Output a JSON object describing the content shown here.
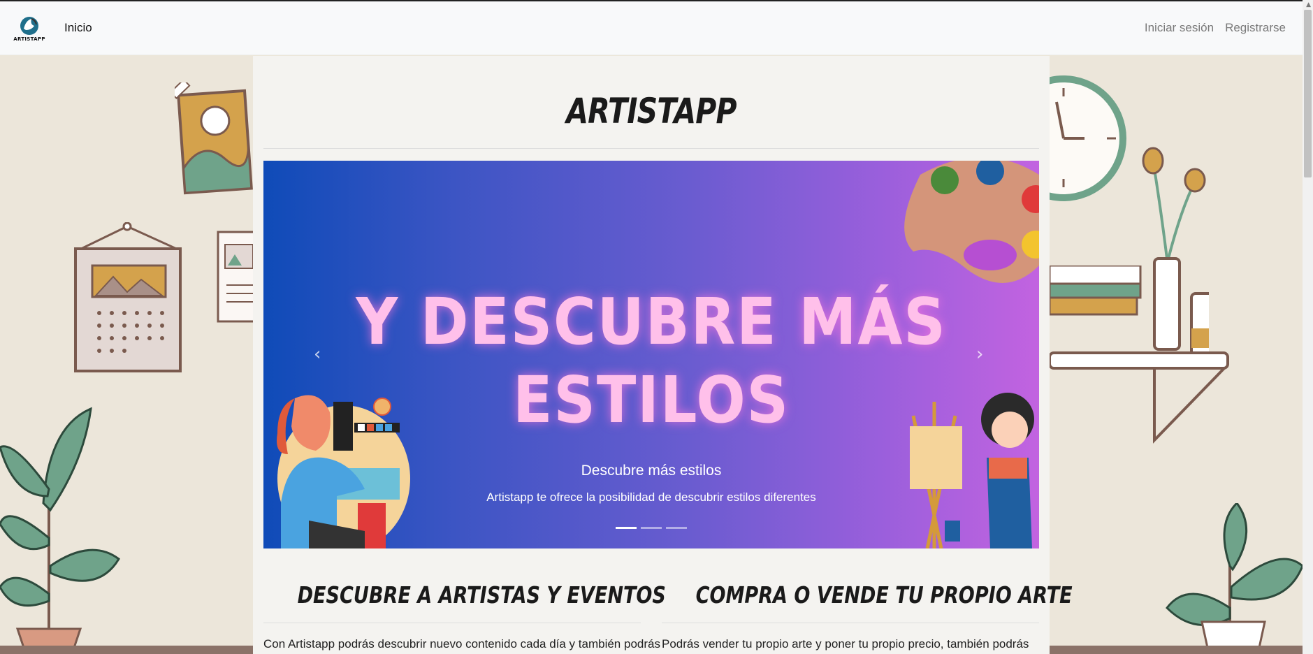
{
  "navbar": {
    "logo_text": "ARTISTAPP",
    "home_link": "Inicio",
    "login_link": "Iniciar sesión",
    "register_link": "Registrarse"
  },
  "main": {
    "site_title": "ARTISTAPP",
    "carousel": {
      "headline": "Y DESCUBRE MÁS ESTILOS",
      "caption_title": "Descubre más estilos",
      "caption_text": "Artistapp te ofrece la posibilidad de descubrir estilos diferentes",
      "slide_count": 3,
      "active_slide": 1
    },
    "sections": [
      {
        "heading": "DESCUBRE A ARTISTAS Y EVENTOS",
        "text": "Con Artistapp podrás descubrir nuevo contenido cada día y también podrás"
      },
      {
        "heading": "COMPRA O VENDE TU PROPIO ARTE",
        "text": "Podrás vender tu propio arte y poner tu propio precio, también podrás"
      }
    ]
  },
  "colors": {
    "page_background": "#ece6da",
    "content_background": "#f4f3f0",
    "navbar_background": "#f8f9fa",
    "headline_pink": "#ffc0ea",
    "gradient_start": "#0f4bb8",
    "gradient_end": "#c263e0"
  },
  "icons": [
    "artistapp-logo-icon",
    "chevron-left-icon",
    "chevron-right-icon"
  ]
}
